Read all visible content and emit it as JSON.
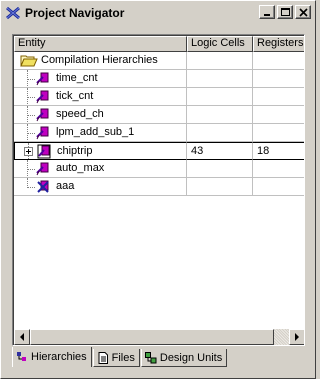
{
  "window": {
    "title": "Project Navigator",
    "buttons": {
      "minimize_icon": "minimize-icon",
      "maximize_icon": "maximize-icon",
      "close_icon": "close-icon"
    }
  },
  "table": {
    "columns": [
      "Entity",
      "Logic Cells",
      "Registers"
    ],
    "rows": [
      {
        "label": "Compilation Hierarchies",
        "icon": "folder-open-icon",
        "logic_cells": "",
        "registers": ""
      },
      {
        "label": "time_cnt",
        "icon": "entity-icon",
        "logic_cells": "",
        "registers": ""
      },
      {
        "label": "tick_cnt",
        "icon": "entity-icon",
        "logic_cells": "",
        "registers": ""
      },
      {
        "label": "speed_ch",
        "icon": "entity-icon",
        "logic_cells": "",
        "registers": ""
      },
      {
        "label": "lpm_add_sub_1",
        "icon": "entity-icon",
        "logic_cells": "",
        "registers": ""
      },
      {
        "label": "chiptrip",
        "icon": "entity-icon",
        "logic_cells": "43",
        "registers": "18"
      },
      {
        "label": "auto_max",
        "icon": "entity-icon",
        "logic_cells": "",
        "registers": ""
      },
      {
        "label": "aaa",
        "icon": "entity-error-icon",
        "logic_cells": "",
        "registers": ""
      }
    ]
  },
  "tabs": [
    {
      "label": "Hierarchies",
      "icon": "hierarchy-icon"
    },
    {
      "label": "Files",
      "icon": "file-icon"
    },
    {
      "label": "Design Units",
      "icon": "design-units-icon"
    }
  ],
  "colors": {
    "face": "#d4d0c8",
    "entity_magenta": "#c000c0",
    "selection_border": "#000000"
  }
}
